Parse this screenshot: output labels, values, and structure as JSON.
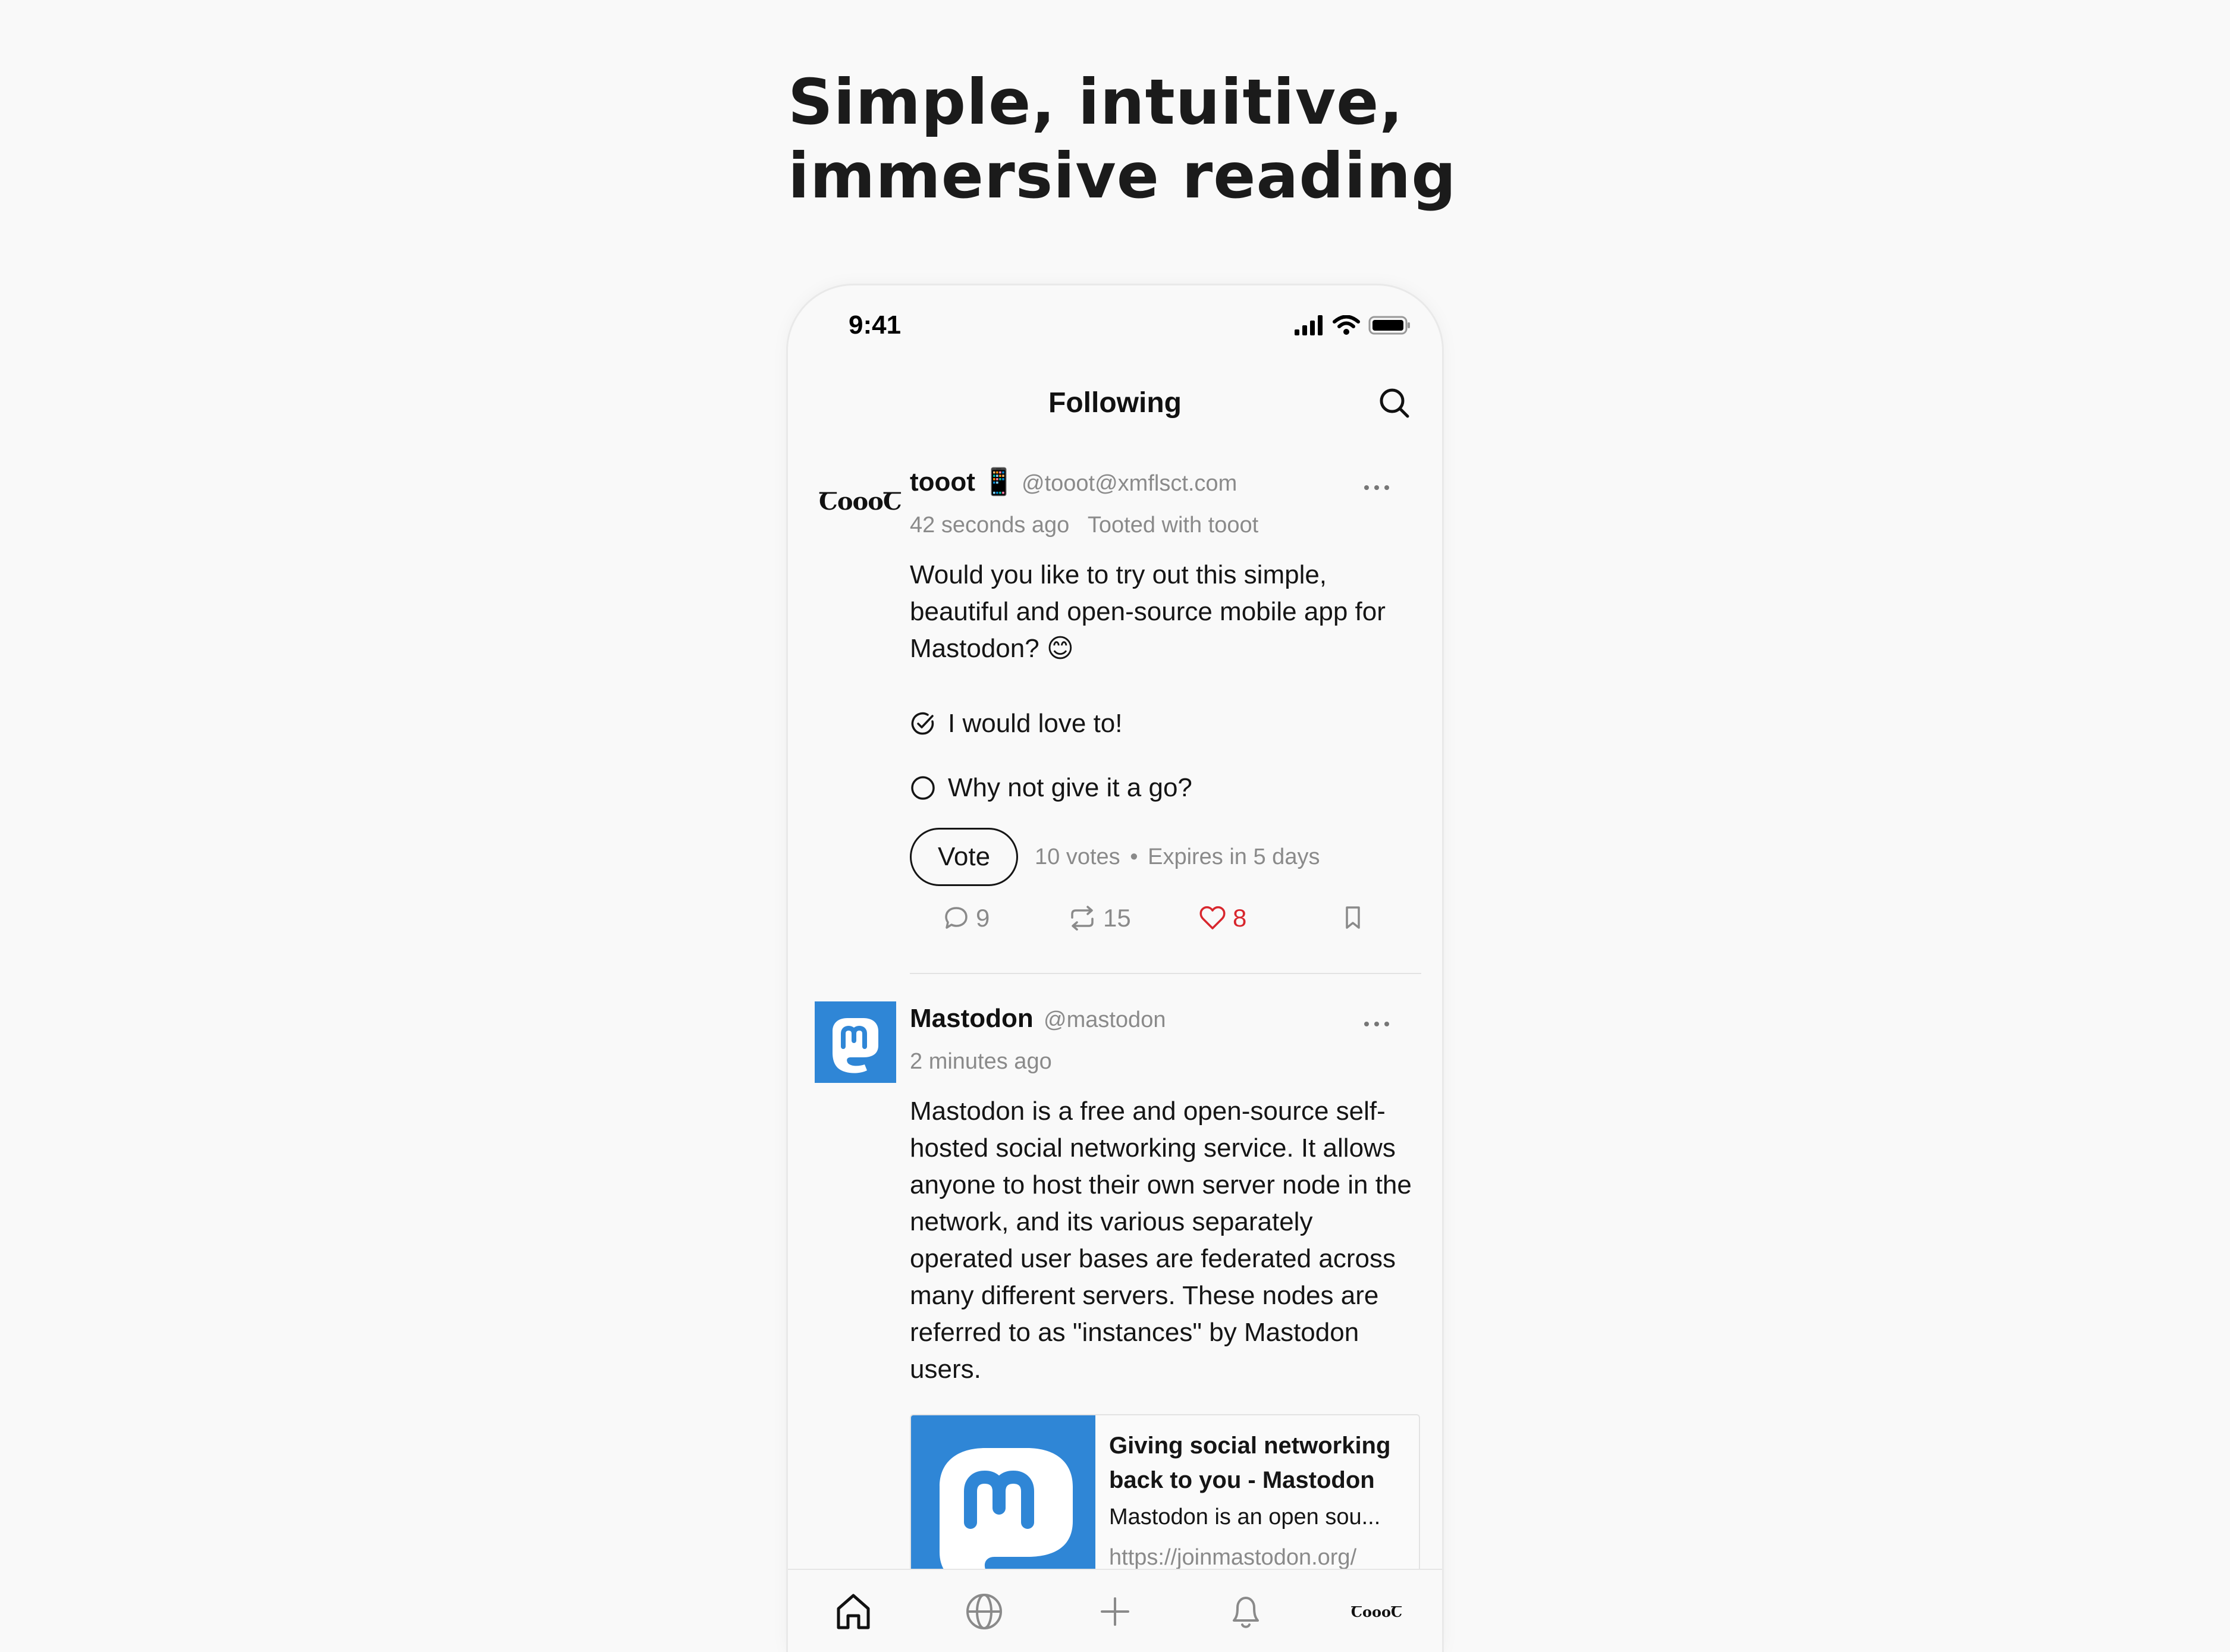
{
  "headline": {
    "line1": "Simple, intuitive,",
    "line2": "immersive reading"
  },
  "status_bar": {
    "time": "9:41"
  },
  "header": {
    "title": "Following",
    "search_icon": "search-icon"
  },
  "posts": [
    {
      "avatar_text": "ꞆoooꞆ",
      "name": "tooot",
      "name_emoji": "📱",
      "handle": "@tooot@xmflsct.com",
      "time": "42 seconds ago",
      "client": "Tooted with tooot",
      "body": "Would you like to try out this simple, beautiful and open-source mobile app for Mastodon? 😊",
      "poll": {
        "options": [
          {
            "label": "I would love to!",
            "selected": true
          },
          {
            "label": "Why not give it a go?",
            "selected": false
          }
        ],
        "vote_label": "Vote",
        "votes": "10 votes",
        "separator": "•",
        "expires": "Expires in 5 days"
      },
      "actions": {
        "replies": "9",
        "boosts": "15",
        "favourites": "8",
        "favourited": true
      }
    },
    {
      "name": "Mastodon",
      "handle": "@mastodon",
      "time": "2 minutes ago",
      "body": "Mastodon is a free and open-source self-hosted social networking service. It allows anyone to host their own server node in the network, and its various separately operated user bases are federated across many different servers. These nodes are referred to as \"instances\" by Mastodon users.",
      "card": {
        "title": "Giving social networking back to you - Mastodon",
        "description": "Mastodon is an open sou...",
        "url": "https://joinmastodon.org/"
      }
    }
  ],
  "tab_bar": {
    "tabs": [
      "home-icon",
      "globe-icon",
      "plus-icon",
      "bell-icon",
      "tooot-logo"
    ],
    "logo_text": "ꞆoooꞆ"
  },
  "colors": {
    "accent_like": "#d8262d",
    "mastodon_blue": "#2f86d6",
    "muted": "#8a8a8a"
  }
}
